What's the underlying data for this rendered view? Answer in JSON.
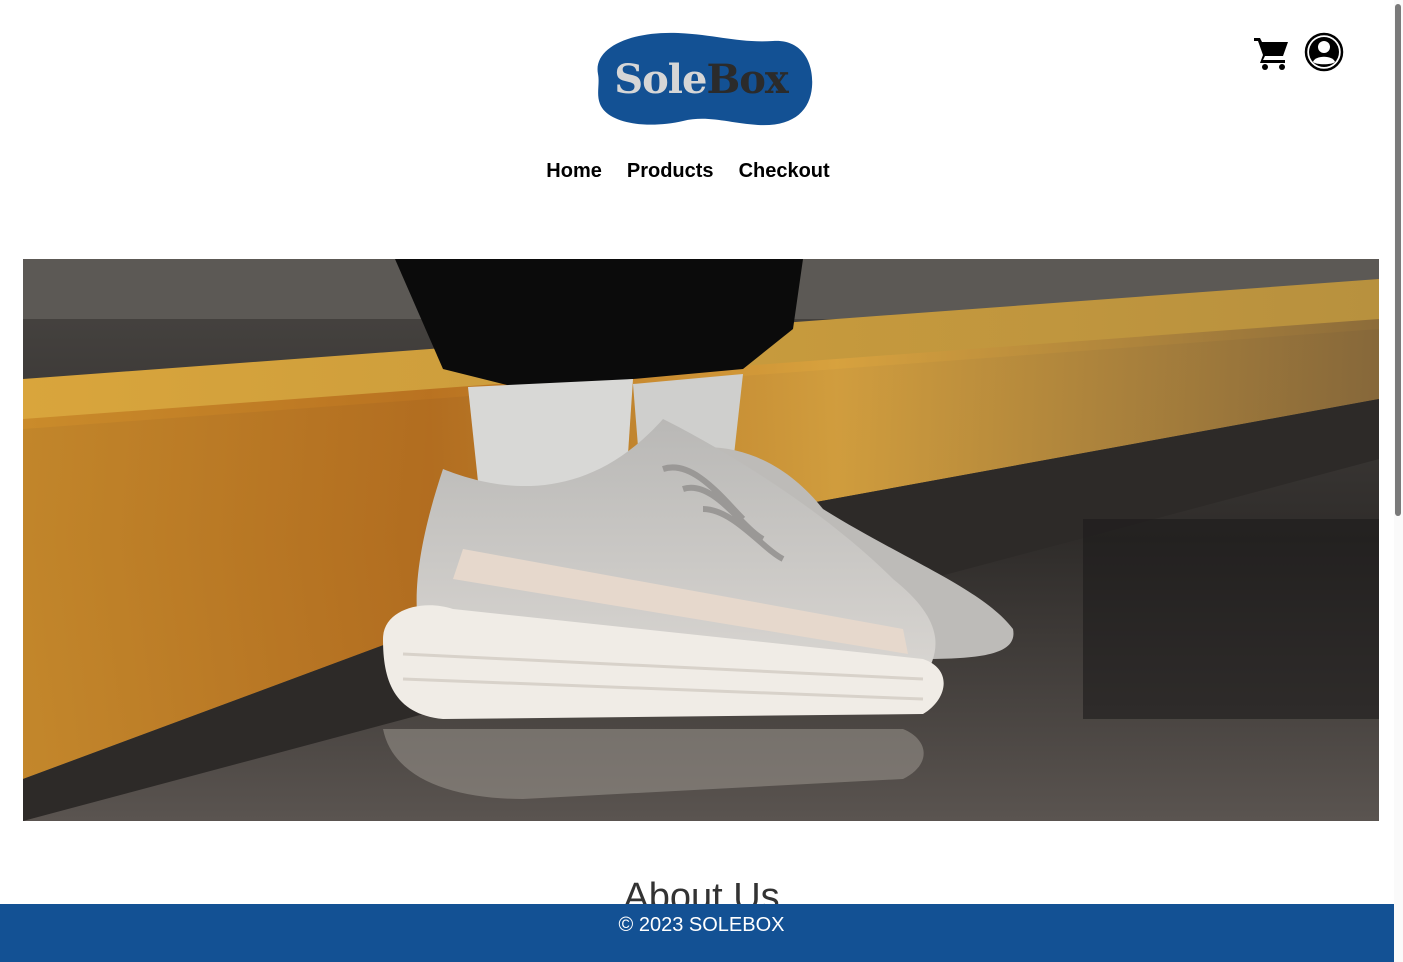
{
  "brand": {
    "logo_part1": "Sole",
    "logo_part2": "Box",
    "color": "#135194"
  },
  "header": {
    "cart_icon": "shopping-cart-icon",
    "account_icon": "user-circle-icon"
  },
  "nav": {
    "items": [
      "Home",
      "Products",
      "Checkout"
    ]
  },
  "hero": {
    "image_subject": "grey knit sneakers on wet pavement beside yellow curb"
  },
  "about": {
    "title": "About Us"
  },
  "footer": {
    "text": "© 2023 SOLEBOX"
  }
}
